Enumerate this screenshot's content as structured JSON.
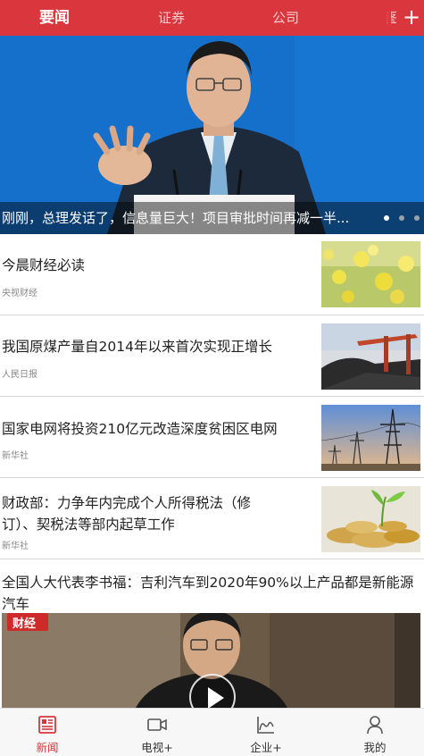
{
  "top_tabs": [
    {
      "label": "要闻"
    },
    {
      "label": "证券"
    },
    {
      "label": "公司"
    },
    {
      "label": "图片"
    }
  ],
  "add_tab_symbol": "+",
  "banner": {
    "title": "刚刚，总理发话了，信息量巨大！项目审批时间再减一半...",
    "slide_count": 3,
    "active_slide": 1
  },
  "news": [
    {
      "title": "今晨财经必读",
      "source": "央视财经",
      "thumb": "flower-field-photo"
    },
    {
      "title": "我国原煤产量自2014年以来首次实现正增长",
      "source": "人民日报",
      "thumb": "coal-yard-photo"
    },
    {
      "title": "国家电网将投资210亿元改造深度贫困区电网",
      "source": "新华社",
      "thumb": "power-tower-photo"
    },
    {
      "title": "财政部：力争年内完成个人所得税法（修订）、契税法等部内起草工作",
      "source": "新华社",
      "thumb": "coins-sprout-photo"
    }
  ],
  "featured": {
    "title": "全国人大代表李书福：吉利汽车到2020年90%以上产品都是新能源汽车",
    "logo_text": "财经",
    "play_icon": "play-icon"
  },
  "bottom_nav": [
    {
      "label": "新闻",
      "icon": "newspaper-icon"
    },
    {
      "label": "电视+",
      "icon": "video-camera-icon"
    },
    {
      "label": "企业+",
      "icon": "chart-icon"
    },
    {
      "label": "我的",
      "icon": "person-icon"
    }
  ],
  "colors": {
    "brand": "#d9363e",
    "hero_bg": "#1166c3"
  }
}
